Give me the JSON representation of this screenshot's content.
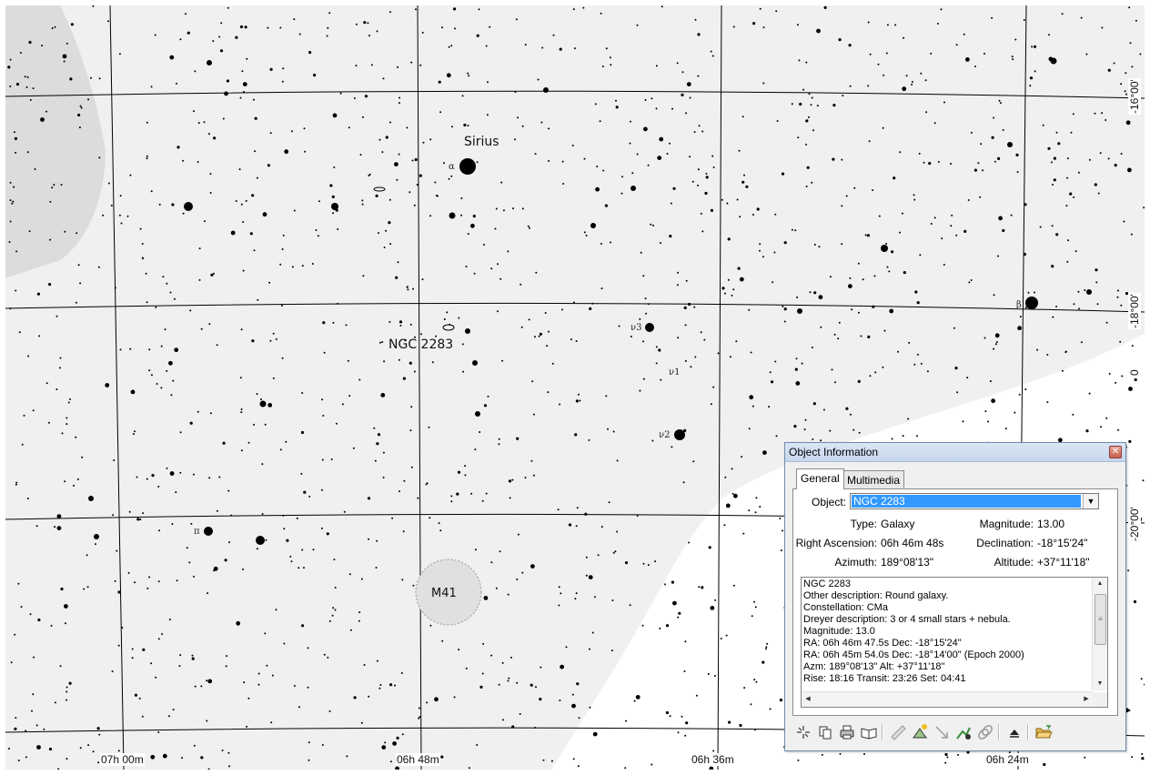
{
  "chart": {
    "star_labels": {
      "sirius": "Sirius",
      "ngc2283": "NGC 2283",
      "m41": "M41"
    },
    "greek_labels": {
      "alpha": "α",
      "beta": "β",
      "nu3": "ν3",
      "nu1": "ν1",
      "nu2": "ν2",
      "pi": "π"
    },
    "ra_labels": [
      "07h 00m",
      "06h 48m",
      "06h 36m",
      "06h 24m"
    ],
    "dec_labels": [
      "-16°00'",
      "-18°00'",
      "-20°00'"
    ],
    "dec_partial": "0",
    "colors": {
      "background": "#f0f0f0",
      "sky_light": "#ffffff",
      "milkyway": "#dcdcdc",
      "grid": "#000000",
      "stars": "#000000"
    }
  },
  "dialog": {
    "title": "Object Information",
    "close_glyph": "✕",
    "tabs": [
      "General",
      "Multimedia"
    ],
    "object_label": "Object:",
    "object_value": "NGC 2283",
    "fields": {
      "type_label": "Type:",
      "type_value": "Galaxy",
      "magnitude_label": "Magnitude:",
      "magnitude_value": "13.00",
      "ra_label": "Right Ascension:",
      "ra_value": "06h 46m 48s",
      "dec_label": "Declination:",
      "dec_value": "-18°15'24\"",
      "azimuth_label": "Azimuth:",
      "azimuth_value": "189°08'13\"",
      "altitude_label": "Altitude:",
      "altitude_value": "+37°11'18\""
    },
    "description": [
      "NGC 2283",
      "Other description: Round galaxy.",
      "Constellation:  CMa",
      "Dreyer description: 3 or 4 small stars + nebula.",
      "Magnitude: 13.0",
      "RA: 06h 46m 47.5s  Dec: -18°15'24\"",
      "RA: 06h 45m 54.0s  Dec: -18°14'00\"  (Epoch 2000)",
      "Azm: 189°08'13\"  Alt: +37°11'18\"",
      "Rise: 18:16  Transit: 23:26  Set: 04:41"
    ],
    "toolbar_icons": [
      "center-icon",
      "copy-icon",
      "print-icon",
      "book-icon",
      "ruler-icon",
      "add-observation-icon",
      "arrow-icon",
      "chart-icon",
      "link-icon",
      "up-icon",
      "open-folder-icon"
    ]
  }
}
